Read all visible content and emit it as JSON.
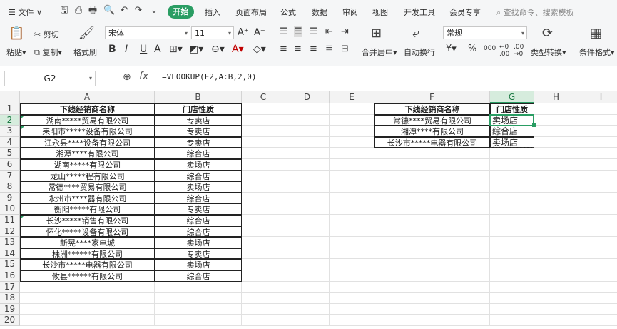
{
  "menu": {
    "file": "文件",
    "tabs": [
      "开始",
      "插入",
      "页面布局",
      "公式",
      "数据",
      "审阅",
      "视图",
      "开发工具",
      "会员专享"
    ],
    "search": "查找命令、搜索模板"
  },
  "ribbon": {
    "paste": "粘贴",
    "cut": "剪切",
    "copy": "复制",
    "format_painter": "格式刷",
    "font_name": "宋体",
    "font_size": "11",
    "merge_center": "合并居中",
    "wrap_text": "自动换行",
    "number_format": "常规",
    "type_convert": "类型转换",
    "cond_format": "条件格式"
  },
  "formula_bar": {
    "name_box": "G2",
    "fx": "fx",
    "formula": "=VLOOKUP(F2,A:B,2,0)"
  },
  "columns": [
    "A",
    "B",
    "C",
    "D",
    "E",
    "F",
    "G",
    "H",
    "I"
  ],
  "rows": [
    "1",
    "2",
    "3",
    "4",
    "5",
    "6",
    "7",
    "8",
    "9",
    "10",
    "11",
    "12",
    "13",
    "14",
    "15",
    "16",
    "17",
    "18",
    "19",
    "20"
  ],
  "table_left": {
    "header_a": "下线经销商名称",
    "header_b": "门店性质",
    "rows": [
      [
        "湖南*****贸易有限公司",
        "专卖店"
      ],
      [
        "耒阳市*****设备有限公司",
        "专卖店"
      ],
      [
        "江永县****设备有限公司",
        "专卖店"
      ],
      [
        "湘潭****有限公司",
        "综合店"
      ],
      [
        "湖南*****有限公司",
        "卖场店"
      ],
      [
        "龙山*****程有限公司",
        "综合店"
      ],
      [
        "常德****贸易有限公司",
        "卖场店"
      ],
      [
        "永州市****器有限公司",
        "综合店"
      ],
      [
        "衡阳*****有限公司",
        "专卖店"
      ],
      [
        "长沙*****销售有限公司",
        "综合店"
      ],
      [
        "怀化*****设备有限公司",
        "综合店"
      ],
      [
        "新晃****家电城",
        "卖场店"
      ],
      [
        "株洲******有限公司",
        "专卖店"
      ],
      [
        "长沙市*****电器有限公司",
        "卖场店"
      ],
      [
        "攸县******有限公司",
        "综合店"
      ]
    ]
  },
  "table_right": {
    "header_f": "下线经销商名称",
    "header_g": "门店性质",
    "rows": [
      [
        "常德****贸易有限公司",
        "卖场店"
      ],
      [
        "湘潭****有限公司",
        "综合店"
      ],
      [
        "长沙市*****电器有限公司",
        "卖场店"
      ]
    ]
  },
  "colors": {
    "accent": "#2a9d63"
  }
}
